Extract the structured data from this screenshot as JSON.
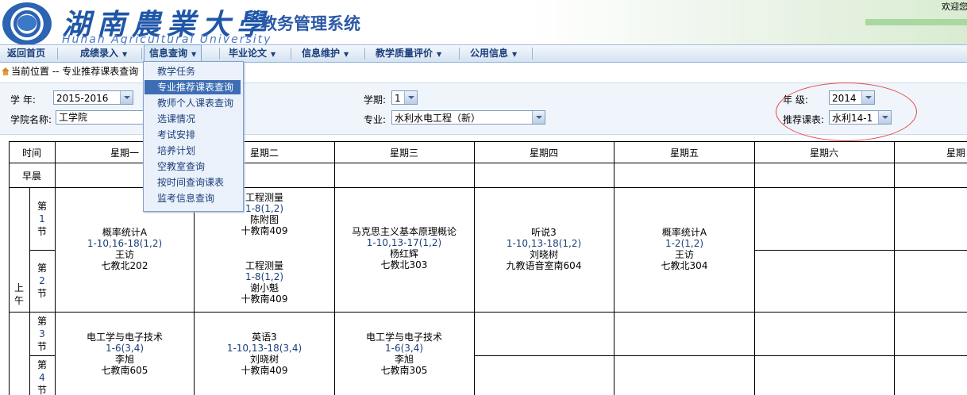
{
  "header": {
    "logo_cn": "湖南農業大學",
    "logo_en": "Hunan Agricultural University",
    "system_title": "教务管理系统",
    "welcome": "欢迎您"
  },
  "nav": {
    "items": [
      {
        "label": "返回首页"
      },
      {
        "label": "成绩录入"
      },
      {
        "label": "信息查询"
      },
      {
        "label": "毕业论文"
      },
      {
        "label": "信息维护"
      },
      {
        "label": "教学质量评价"
      },
      {
        "label": "公用信息"
      }
    ],
    "dropdown": [
      "教学任务",
      "专业推荐课表查询",
      "教师个人课表查询",
      "选课情况",
      "考试安排",
      "培养计划",
      "空教室查询",
      "按时间查询课表",
      "监考信息查询"
    ]
  },
  "breadcrumb": {
    "prefix": "当前位置",
    "current": " -- 专业推荐课表查询"
  },
  "filters": {
    "year_label": "学  年:",
    "year_value": "2015-2016",
    "term_label": "学期:",
    "term_value": "1",
    "grade_label": "年  级:",
    "grade_value": "2014",
    "college_label": "学院名称:",
    "college_value": "工学院",
    "major_label": "专业:",
    "major_value": "水利水电工程（新）",
    "recommend_label": "推荐课表:",
    "recommend_value": "水利14-1"
  },
  "timetable": {
    "time_header": "时间",
    "days": [
      "星期一",
      "星期二",
      "星期三",
      "星期四",
      "星期五",
      "星期六",
      "星期日"
    ],
    "early_label": "早晨",
    "morning_label": "上午",
    "periods": [
      {
        "pre": "第",
        "num": "1",
        "post": "节"
      },
      {
        "pre": "第",
        "num": "2",
        "post": "节"
      },
      {
        "pre": "第",
        "num": "3",
        "post": "节"
      },
      {
        "pre": "第",
        "num": "4",
        "post": "节"
      }
    ],
    "courses": {
      "mon_12": {
        "name": "概率统计A",
        "weeks": "1-10,16-18(1,2)",
        "teacher": "王访",
        "room": "七教北202"
      },
      "tue_1": {
        "name": "工程测量",
        "weeks": "1-8(1,2)",
        "teacher": "陈附图",
        "room": "十教南409"
      },
      "tue_2": {
        "name": "工程测量",
        "weeks": "1-8(1,2)",
        "teacher": "谢小魁",
        "room": "十教南409"
      },
      "wed_12": {
        "name": "马克思主义基本原理概论",
        "weeks": "1-10,13-17(1,2)",
        "teacher": "杨红辉",
        "room": "七教北303"
      },
      "thu_12": {
        "name": "听说3",
        "weeks": "1-10,13-18(1,2)",
        "teacher": "刘晓树",
        "room": "九教语音室南604"
      },
      "fri_12": {
        "name": "概率统计A",
        "weeks": "1-2(1,2)",
        "teacher": "王访",
        "room": "七教北304"
      },
      "mon_34": {
        "name": "电工学与电子技术",
        "weeks": "1-6(3,4)",
        "teacher": "李旭",
        "room": "七教南605"
      },
      "tue_34": {
        "name": "英语3",
        "weeks": "1-10,13-18(3,4)",
        "teacher": "刘晓树",
        "room": "十教南409"
      },
      "wed_34": {
        "name": "电工学与电子技术",
        "weeks": "1-6(3,4)",
        "teacher": "李旭",
        "room": "七教南305"
      }
    }
  }
}
